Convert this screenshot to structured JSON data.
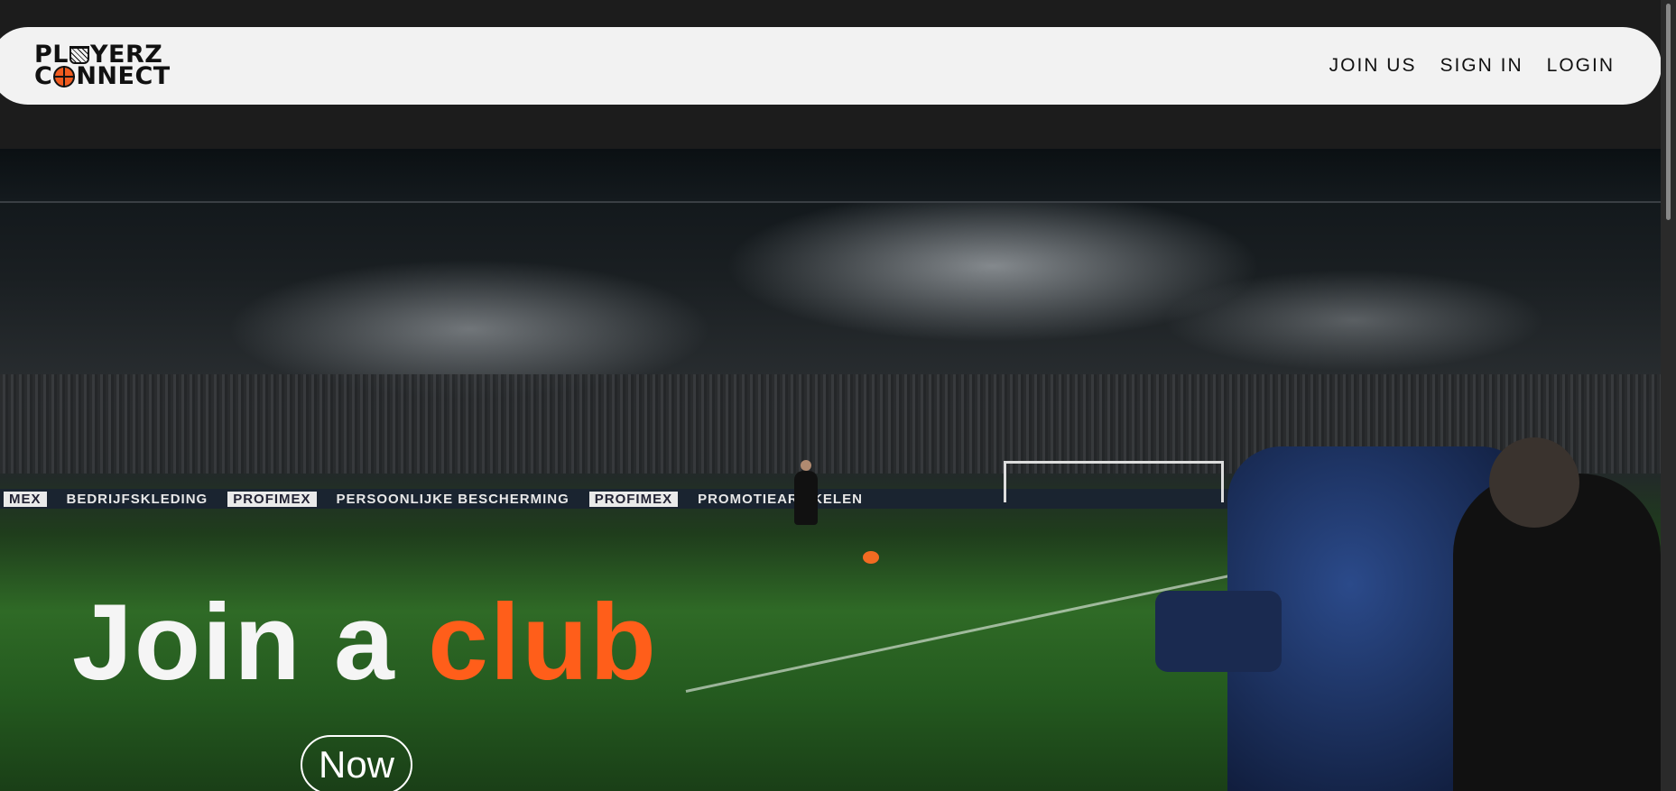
{
  "logo": {
    "line1_a": "PL",
    "line1_b": "YERZ",
    "line2_a": "C",
    "line2_b": "NNECT",
    "alt": "PLAYERZ CONNECT"
  },
  "nav": {
    "items": [
      {
        "label": "JOIN US"
      },
      {
        "label": "SIGN IN"
      },
      {
        "label": "LOGIN"
      }
    ]
  },
  "hero": {
    "title_main": "Join a ",
    "title_accent": "club",
    "button_label": "Now",
    "adboard": [
      "MEX",
      "BEDRIJFSKLEDING",
      "PROFIMEX",
      "PERSOONLIJKE BESCHERMING",
      "PROFIMEX",
      "PROMOTIEARTIKELEN"
    ]
  },
  "colors": {
    "accent": "#ff5e1a",
    "nav_bg": "#f2f2f2",
    "page_bg": "#1c1c1c"
  }
}
